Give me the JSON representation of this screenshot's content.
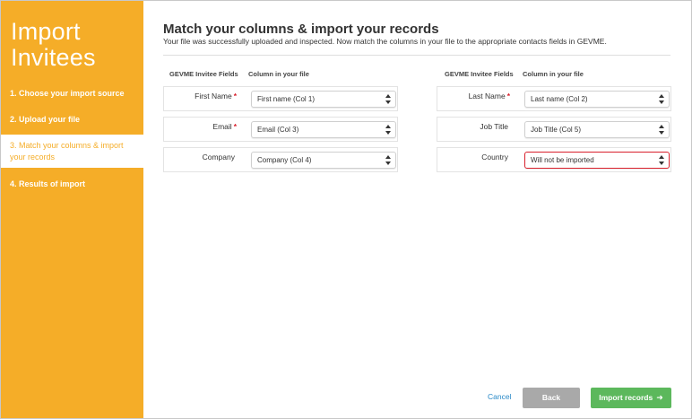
{
  "sidebar": {
    "title_line1": "Import",
    "title_line2": "Invitees",
    "steps": [
      {
        "label": "1. Choose your import source"
      },
      {
        "label": "2. Upload your file"
      },
      {
        "label_line1": "3. Match your columns & import",
        "label_line2": "your records"
      },
      {
        "label": "4. Results of import"
      }
    ],
    "active_step": 3
  },
  "main": {
    "title": "Match your columns & import your records",
    "subtitle": "Your file was successfully uploaded and inspected. Now match the columns in your file to the appropriate contacts fields in GEVME.",
    "columns": {
      "field_header": "GEVME Invitee Fields",
      "file_header": "Column in your file"
    },
    "left_rows": [
      {
        "field": "First Name",
        "required": "*",
        "value": "First name (Col 1)"
      },
      {
        "field": "Email",
        "required": "*",
        "value": "Email (Col 3)"
      },
      {
        "field": "Company",
        "required": "",
        "value": "Company (Col 4)"
      }
    ],
    "right_rows": [
      {
        "field": "Last Name",
        "required": "*",
        "value": "Last name (Col 2)"
      },
      {
        "field": "Job Title",
        "required": "",
        "value": "Job Title (Col 5)"
      },
      {
        "field": "Country",
        "required": "",
        "value": "Will not be imported",
        "state": "error"
      }
    ]
  },
  "footer": {
    "cancel_label": "Cancel",
    "back_label": "Back",
    "import_label": "Import records"
  },
  "colors": {
    "sidebar_bg": "#f5ad28",
    "required": "#d9202c",
    "primary_button": "#5cb85c",
    "secondary_button": "#a9a9a9",
    "link": "#2a8ac8"
  },
  "icons": {
    "select_arrows": "updown-arrows-icon",
    "import_arrow": "arrow-right-icon"
  }
}
